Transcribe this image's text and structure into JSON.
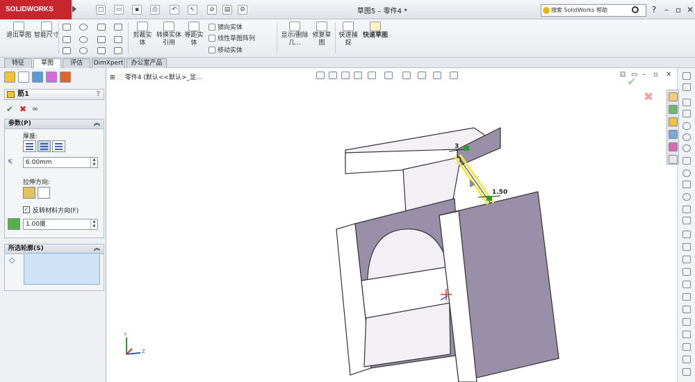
{
  "app": {
    "brand": "SOLIDWORKS",
    "document_title": "草图5 – 零件4 *",
    "search_placeholder": "搜索 SolidWorks 帮助",
    "help_mark": "?"
  },
  "command_manager": {
    "exit_sketch": "退出草图",
    "smart_dimension": "智能尺寸",
    "trim_entities": "剪裁实体",
    "convert_entities": "转换实体引用",
    "offset_entities": "等距实体",
    "mirror_entities": "镜向实体",
    "linear_pattern": "线性草图阵列",
    "move_entities": "移动实体",
    "display_delete": "显示/删除几...",
    "repair_sketch": "修复草图",
    "quick_snaps": "快速捕捉",
    "rapid_sketch": "快速草图"
  },
  "tabs": [
    "特征",
    "草图",
    "评估",
    "DimXpert",
    "办公室产品"
  ],
  "property_manager": {
    "title": "筋1",
    "help": "?",
    "parameters": {
      "header": "参数(P)",
      "thickness_label": "厚度:",
      "thickness_value": "6.00mm",
      "extrusion_direction_label": "拉伸方向:",
      "flip_material_label": "反转材料方向(F)",
      "flip_material_checked": true,
      "draft_value": "1.00度"
    },
    "selected_contours": {
      "header": "所选轮廓(S)"
    }
  },
  "viewport": {
    "tree_label": "零件4 (默认<<默认>_显...",
    "dimension_top": "3",
    "dimension_side": "1.50",
    "axis_y": "Y",
    "axis_z": "Z"
  },
  "colors": {
    "brand_red": "#c8262e",
    "model_face": "#ece8f0",
    "model_shade": "#9a8fa8",
    "sketch_yellow": "#f0ea3a",
    "confirm_green": "#2e9b2e",
    "cancel_red": "#d9262c"
  }
}
